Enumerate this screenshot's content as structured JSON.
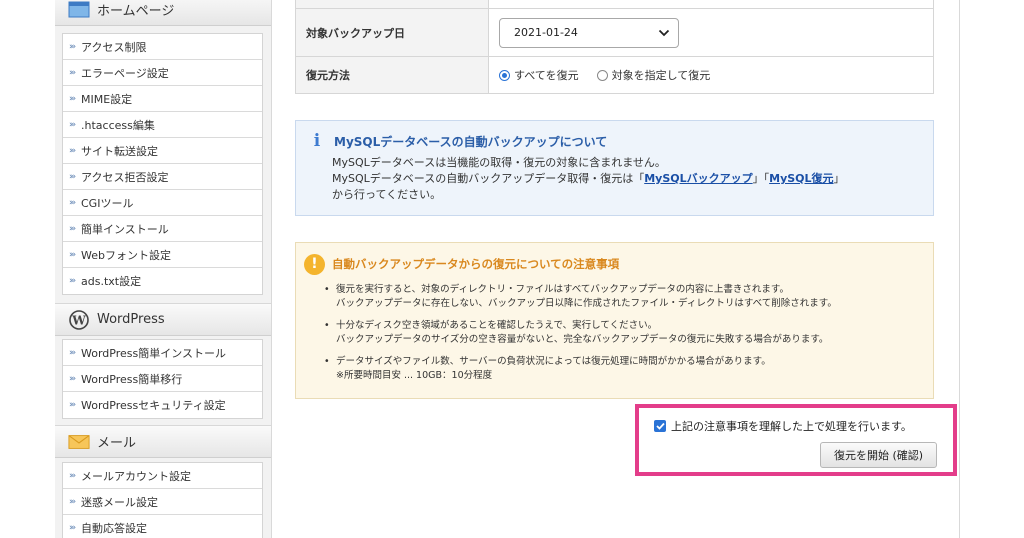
{
  "sidebar": {
    "sections": [
      {
        "title": "ホームページ",
        "icon": "homepage-icon",
        "items": [
          "アクセス制限",
          "エラーページ設定",
          "MIME設定",
          ".htaccess編集",
          "サイト転送設定",
          "アクセス拒否設定",
          "CGIツール",
          "簡単インストール",
          "Webフォント設定",
          "ads.txt設定"
        ]
      },
      {
        "title": "WordPress",
        "icon": "wordpress-icon",
        "items": [
          "WordPress簡単インストール",
          "WordPress簡単移行",
          "WordPressセキュリティ設定"
        ]
      },
      {
        "title": "メール",
        "icon": "mail-icon",
        "items": [
          "メールアカウント設定",
          "迷惑メール設定",
          "自動応答設定"
        ]
      }
    ]
  },
  "form": {
    "date_label": "対象バックアップ日",
    "date_value": "2021-01-24",
    "method_label": "復元方法",
    "method_options": [
      "すべてを復元",
      "対象を指定して復元"
    ],
    "method_selected": 0
  },
  "info": {
    "title": "MySQLデータベースの自動バックアップについて",
    "line1": "MySQLデータベースは当機能の取得・復元の対象に含まれません。",
    "line2_prefix": "MySQLデータベースの自動バックアップデータ取得・復元は「",
    "link1": "MySQLバックアップ",
    "line2_mid": "」「",
    "link2": "MySQL復元",
    "line2_suffix": "」",
    "line3": "から行ってください。"
  },
  "warning": {
    "title": "自動バックアップデータからの復元についての注意事項",
    "items": [
      [
        "復元を実行すると、対象のディレクトリ・ファイルはすべてバックアップデータの内容に上書きされます。",
        "バックアップデータに存在しない、バックアップ日以降に作成されたファイル・ディレクトリはすべて削除されます。"
      ],
      [
        "十分なディスク空き領域があることを確認したうえで、実行してください。",
        "バックアップデータのサイズ分の空き容量がないと、完全なバックアップデータの復元に失敗する場合があります。"
      ],
      [
        "データサイズやファイル数、サーバーの負荷状況によっては復元処理に時間がかかる場合があります。",
        "※所要時間目安 ... 10GB：10分程度"
      ]
    ]
  },
  "confirm": {
    "checkbox_label": "上記の注意事項を理解した上で処理を行います。",
    "checked": true,
    "button_label": "復元を開始 (確認)"
  },
  "colors": {
    "highlight": "#e33d8a",
    "link": "#1a4fa6",
    "warning": "#f4b42d"
  }
}
